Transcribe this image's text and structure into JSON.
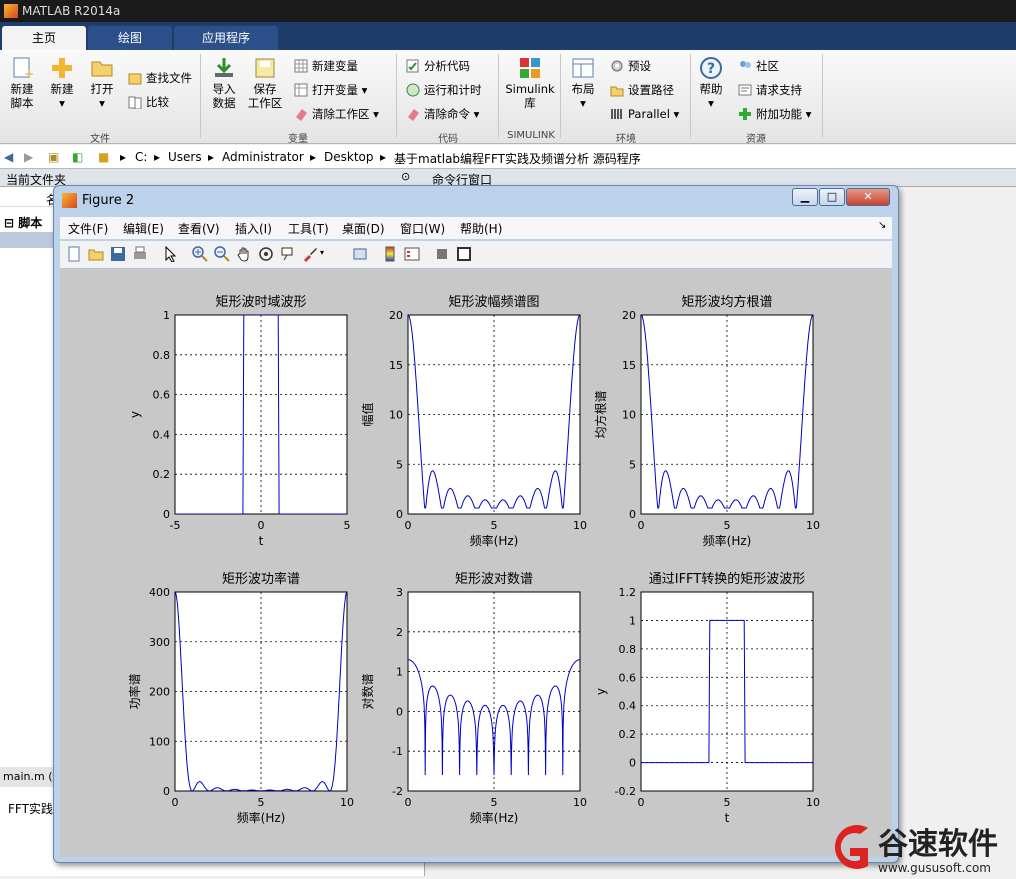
{
  "app": {
    "title": "MATLAB R2014a"
  },
  "tabs": [
    "主页",
    "绘图",
    "应用程序"
  ],
  "ribbon": {
    "new_script": "新建\n脚本",
    "new": "新建",
    "open": "打开",
    "find_files": "查找文件",
    "compare": "比较",
    "import": "导入\n数据",
    "save_ws": "保存\n工作区",
    "new_var": "新建变量",
    "open_var": "打开变量",
    "clear_ws": "清除工作区",
    "analyze": "分析代码",
    "run_time": "运行和计时",
    "clear_cmd": "清除命令",
    "simulink": "Simulink\n库",
    "layout": "布局",
    "prefs": "预设",
    "set_path": "设置路径",
    "parallel": "Parallel",
    "help": "帮助",
    "community": "社区",
    "support": "请求支持",
    "addons": "附加功能",
    "groups": [
      "文件",
      "变量",
      "代码",
      "SIMULINK",
      "环境",
      "资源"
    ]
  },
  "address": {
    "parts": [
      "C:",
      "Users",
      "Administrator",
      "Desktop",
      "基于matlab编程FFT实践及频谱分析 源码程序"
    ]
  },
  "panels": {
    "current_folder": "当前文件夹",
    "command_window": "命令行窗口",
    "script_label": "脚本",
    "col_name": "名",
    "editor_tab": "main.m (",
    "editor_text": "FFT实践"
  },
  "figure": {
    "title": "Figure 2",
    "menu": [
      "文件(F)",
      "编辑(E)",
      "查看(V)",
      "插入(I)",
      "工具(T)",
      "桌面(D)",
      "窗口(W)",
      "帮助(H)"
    ]
  },
  "chart_data": [
    {
      "type": "line",
      "title": "矩形波时域波形",
      "xlabel": "t",
      "ylabel": "y",
      "xlim": [
        -5,
        5
      ],
      "ylim": [
        0,
        1
      ],
      "xticks": [
        "-5",
        "0",
        "5"
      ],
      "yticks": [
        "0",
        "0.2",
        "0.4",
        "0.6",
        "0.8",
        "1"
      ],
      "grid": true,
      "x": [
        -5,
        -1.05,
        -1,
        1,
        1.05,
        5
      ],
      "y": [
        0,
        0,
        1,
        1,
        0,
        0
      ]
    },
    {
      "type": "line",
      "title": "矩形波幅频谱图",
      "xlabel": "频率(Hz)",
      "ylabel": "幅值",
      "xlim": [
        0,
        10
      ],
      "ylim": [
        0,
        20
      ],
      "xticks": [
        "0",
        "5",
        "10"
      ],
      "yticks": [
        "0",
        "5",
        "10",
        "15",
        "20"
      ],
      "grid": true,
      "curve": "amp",
      "peak": 20
    },
    {
      "type": "line",
      "title": "矩形波均方根谱",
      "xlabel": "频率(Hz)",
      "ylabel": "均方根谱",
      "xlim": [
        0,
        10
      ],
      "ylim": [
        0,
        20
      ],
      "xticks": [
        "0",
        "5",
        "10"
      ],
      "yticks": [
        "0",
        "5",
        "10",
        "15",
        "20"
      ],
      "grid": true,
      "curve": "amp",
      "peak": 20
    },
    {
      "type": "line",
      "title": "矩形波功率谱",
      "xlabel": "频率(Hz)",
      "ylabel": "功率谱",
      "xlim": [
        0,
        10
      ],
      "ylim": [
        0,
        400
      ],
      "xticks": [
        "0",
        "5",
        "10"
      ],
      "yticks": [
        "0",
        "100",
        "200",
        "300",
        "400"
      ],
      "grid": true,
      "curve": "power",
      "peak": 400
    },
    {
      "type": "line",
      "title": "矩形波对数谱",
      "xlabel": "频率(Hz)",
      "ylabel": "对数谱",
      "xlim": [
        0,
        10
      ],
      "ylim": [
        -2,
        3
      ],
      "xticks": [
        "0",
        "5",
        "10"
      ],
      "yticks": [
        "-2",
        "-1",
        "0",
        "1",
        "2",
        "3"
      ],
      "grid": true,
      "curve": "log"
    },
    {
      "type": "line",
      "title": "通过IFFT转换的矩形波波形",
      "xlabel": "t",
      "ylabel": "y",
      "xlim": [
        0,
        10
      ],
      "ylim": [
        -0.2,
        1.2
      ],
      "xticks": [
        "0",
        "5",
        "10"
      ],
      "yticks": [
        "-0.2",
        "0",
        "0.2",
        "0.4",
        "0.6",
        "0.8",
        "1",
        "1.2"
      ],
      "grid": true,
      "x": [
        0,
        3.95,
        4,
        6,
        6.05,
        10
      ],
      "y": [
        0,
        0,
        1,
        1,
        0,
        0
      ]
    }
  ],
  "watermark": {
    "brand": "谷速软件",
    "url": "www.gususoft.com"
  }
}
